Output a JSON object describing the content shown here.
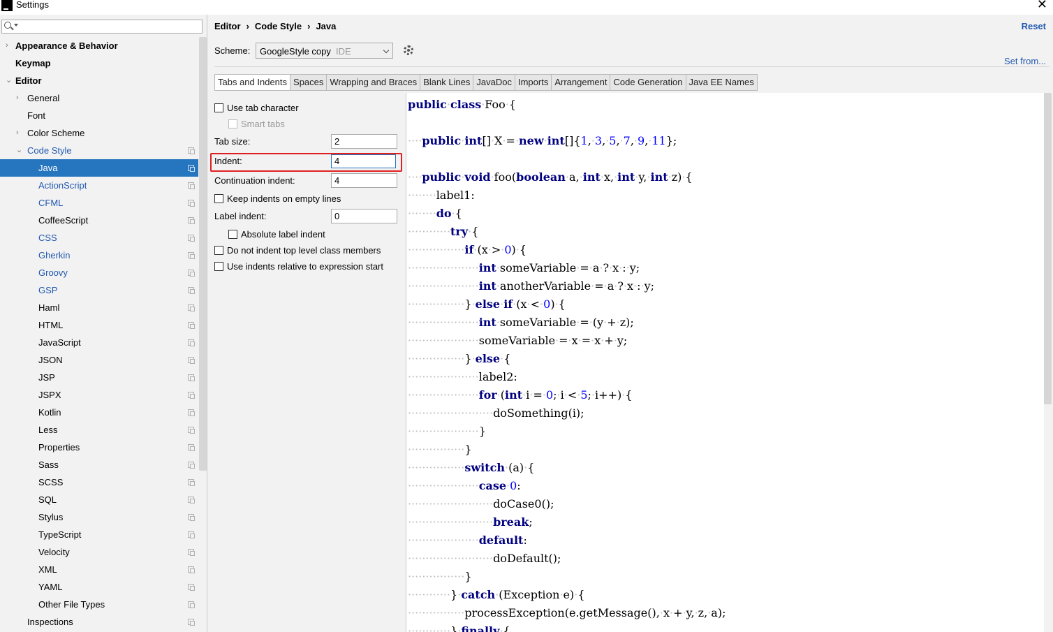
{
  "window": {
    "title": "Settings"
  },
  "search": {
    "placeholder": ""
  },
  "tree": [
    {
      "label": "Appearance & Behavior",
      "level": 0,
      "arrow": "›",
      "bold": true
    },
    {
      "label": "Keymap",
      "level": 0,
      "arrow": "",
      "bold": true
    },
    {
      "label": "Editor",
      "level": 0,
      "arrow": "⌄",
      "bold": true
    },
    {
      "label": "General",
      "level": 1,
      "arrow": "›"
    },
    {
      "label": "Font",
      "level": 1,
      "arrow": ""
    },
    {
      "label": "Color Scheme",
      "level": 1,
      "arrow": "›"
    },
    {
      "label": "Code Style",
      "level": 1,
      "arrow": "⌄",
      "blue": true,
      "copy": true
    },
    {
      "label": "Java",
      "level": 2,
      "selected": true,
      "copy": true
    },
    {
      "label": "ActionScript",
      "level": 2,
      "blue": true,
      "copy": true
    },
    {
      "label": "CFML",
      "level": 2,
      "blue": true,
      "copy": true
    },
    {
      "label": "CoffeeScript",
      "level": 2,
      "copy": true
    },
    {
      "label": "CSS",
      "level": 2,
      "blue": true,
      "copy": true
    },
    {
      "label": "Gherkin",
      "level": 2,
      "blue": true,
      "copy": true
    },
    {
      "label": "Groovy",
      "level": 2,
      "blue": true,
      "copy": true
    },
    {
      "label": "GSP",
      "level": 2,
      "blue": true,
      "copy": true
    },
    {
      "label": "Haml",
      "level": 2,
      "copy": true
    },
    {
      "label": "HTML",
      "level": 2,
      "copy": true
    },
    {
      "label": "JavaScript",
      "level": 2,
      "copy": true
    },
    {
      "label": "JSON",
      "level": 2,
      "copy": true
    },
    {
      "label": "JSP",
      "level": 2,
      "copy": true
    },
    {
      "label": "JSPX",
      "level": 2,
      "copy": true
    },
    {
      "label": "Kotlin",
      "level": 2,
      "copy": true
    },
    {
      "label": "Less",
      "level": 2,
      "copy": true
    },
    {
      "label": "Properties",
      "level": 2,
      "copy": true
    },
    {
      "label": "Sass",
      "level": 2,
      "copy": true
    },
    {
      "label": "SCSS",
      "level": 2,
      "copy": true
    },
    {
      "label": "SQL",
      "level": 2,
      "copy": true
    },
    {
      "label": "Stylus",
      "level": 2,
      "copy": true
    },
    {
      "label": "TypeScript",
      "level": 2,
      "copy": true
    },
    {
      "label": "Velocity",
      "level": 2,
      "copy": true
    },
    {
      "label": "XML",
      "level": 2,
      "copy": true
    },
    {
      "label": "YAML",
      "level": 2,
      "copy": true
    },
    {
      "label": "Other File Types",
      "level": 2,
      "copy": true
    },
    {
      "label": "Inspections",
      "level": 1,
      "arrow": "",
      "copy": true
    }
  ],
  "breadcrumb": {
    "part1": "Editor",
    "part2": "Code Style",
    "part3": "Java",
    "separator": "›"
  },
  "reset_label": "Reset",
  "scheme": {
    "label": "Scheme:",
    "value": "GoogleStyle copy",
    "tag": "IDE"
  },
  "set_from_label": "Set from...",
  "tabs": [
    "Tabs and Indents",
    "Spaces",
    "Wrapping and Braces",
    "Blank Lines",
    "JavaDoc",
    "Imports",
    "Arrangement",
    "Code Generation",
    "Java EE Names"
  ],
  "options": {
    "use_tab_character": "Use tab character",
    "smart_tabs": "Smart tabs",
    "tab_size_label": "Tab size:",
    "tab_size_value": "2",
    "indent_label": "Indent:",
    "indent_value": "4",
    "continuation_indent_label": "Continuation indent:",
    "continuation_indent_value": "4",
    "keep_indents_empty": "Keep indents on empty lines",
    "label_indent_label": "Label indent:",
    "label_indent_value": "0",
    "absolute_label_indent": "Absolute label indent",
    "no_indent_top_level": "Do not indent top level class members",
    "indents_relative_expr": "Use indents relative to expression start"
  },
  "code_lines": [
    [
      [
        "kw",
        "public"
      ],
      [
        "",
        "·"
      ],
      [
        "kw",
        "class"
      ],
      [
        "",
        "·Foo·{"
      ]
    ],
    [],
    [
      [
        "ws",
        "····"
      ],
      [
        "kw",
        "public"
      ],
      [
        "",
        "·"
      ],
      [
        "kw",
        "int"
      ],
      [
        "",
        "[]·X·=·"
      ],
      [
        "kw",
        "new"
      ],
      [
        "",
        "·"
      ],
      [
        "kw",
        "int"
      ],
      [
        "",
        "[]{"
      ],
      [
        "num",
        "1"
      ],
      [
        "",
        ",·"
      ],
      [
        "num",
        "3"
      ],
      [
        "",
        ",·"
      ],
      [
        "num",
        "5"
      ],
      [
        "",
        ",·"
      ],
      [
        "num",
        "7"
      ],
      [
        "",
        ",·"
      ],
      [
        "num",
        "9"
      ],
      [
        "",
        ",·"
      ],
      [
        "num",
        "11"
      ],
      [
        "",
        "};"
      ]
    ],
    [],
    [
      [
        "ws",
        "····"
      ],
      [
        "kw",
        "public"
      ],
      [
        "",
        "·"
      ],
      [
        "kw",
        "void"
      ],
      [
        "",
        "·foo("
      ],
      [
        "kw",
        "boolean"
      ],
      [
        "",
        "·a,·"
      ],
      [
        "kw",
        "int"
      ],
      [
        "",
        "·x,·"
      ],
      [
        "kw",
        "int"
      ],
      [
        "",
        "·y,·"
      ],
      [
        "kw",
        "int"
      ],
      [
        "",
        "·z)·{"
      ]
    ],
    [
      [
        "ws",
        "········"
      ],
      [
        "",
        "label1:"
      ]
    ],
    [
      [
        "ws",
        "········"
      ],
      [
        "kw",
        "do"
      ],
      [
        "",
        "·{"
      ]
    ],
    [
      [
        "ws",
        "············"
      ],
      [
        "kw",
        "try"
      ],
      [
        "",
        "·{"
      ]
    ],
    [
      [
        "ws",
        "················"
      ],
      [
        "kw",
        "if"
      ],
      [
        "",
        "·(x·>·"
      ],
      [
        "num",
        "0"
      ],
      [
        "",
        ")·{"
      ]
    ],
    [
      [
        "ws",
        "····················"
      ],
      [
        "kw",
        "int"
      ],
      [
        "",
        "·someVariable·=·a·?·x·:·y;"
      ]
    ],
    [
      [
        "ws",
        "····················"
      ],
      [
        "kw",
        "int"
      ],
      [
        "",
        "·anotherVariable·=·a·?·x·:·y;"
      ]
    ],
    [
      [
        "ws",
        "················"
      ],
      [
        "",
        "}·"
      ],
      [
        "kw",
        "else"
      ],
      [
        "",
        "·"
      ],
      [
        "kw",
        "if"
      ],
      [
        "",
        "·(x·<·"
      ],
      [
        "num",
        "0"
      ],
      [
        "",
        ")·{"
      ]
    ],
    [
      [
        "ws",
        "····················"
      ],
      [
        "kw",
        "int"
      ],
      [
        "",
        "·someVariable·=·(y·+·z);"
      ]
    ],
    [
      [
        "ws",
        "····················"
      ],
      [
        "",
        "someVariable·=·x·=·x·+·y;"
      ]
    ],
    [
      [
        "ws",
        "················"
      ],
      [
        "",
        "}·"
      ],
      [
        "kw",
        "else"
      ],
      [
        "",
        "·{"
      ]
    ],
    [
      [
        "ws",
        "····················"
      ],
      [
        "",
        "label2:"
      ]
    ],
    [
      [
        "ws",
        "····················"
      ],
      [
        "kw",
        "for"
      ],
      [
        "",
        "·("
      ],
      [
        "kw",
        "int"
      ],
      [
        "",
        "·i·=·"
      ],
      [
        "num",
        "0"
      ],
      [
        "",
        ";·i·<·"
      ],
      [
        "num",
        "5"
      ],
      [
        "",
        ";·i++)·{"
      ]
    ],
    [
      [
        "ws",
        "························"
      ],
      [
        "",
        "doSomething(i);"
      ]
    ],
    [
      [
        "ws",
        "····················"
      ],
      [
        "",
        "}"
      ]
    ],
    [
      [
        "ws",
        "················"
      ],
      [
        "",
        "}"
      ]
    ],
    [
      [
        "ws",
        "················"
      ],
      [
        "kw",
        "switch"
      ],
      [
        "",
        "·(a)·{"
      ]
    ],
    [
      [
        "ws",
        "····················"
      ],
      [
        "kw",
        "case"
      ],
      [
        "",
        "·"
      ],
      [
        "num",
        "0"
      ],
      [
        "",
        ":"
      ]
    ],
    [
      [
        "ws",
        "························"
      ],
      [
        "",
        "doCase0();"
      ]
    ],
    [
      [
        "ws",
        "························"
      ],
      [
        "kw",
        "break"
      ],
      [
        "",
        ";"
      ]
    ],
    [
      [
        "ws",
        "····················"
      ],
      [
        "kw",
        "default"
      ],
      [
        "",
        ":"
      ]
    ],
    [
      [
        "ws",
        "························"
      ],
      [
        "",
        "doDefault();"
      ]
    ],
    [
      [
        "ws",
        "················"
      ],
      [
        "",
        "}"
      ]
    ],
    [
      [
        "ws",
        "············"
      ],
      [
        "",
        "}·"
      ],
      [
        "kw",
        "catch"
      ],
      [
        "",
        "·(Exception·e)·{"
      ]
    ],
    [
      [
        "ws",
        "················"
      ],
      [
        "",
        "processException(e.getMessage(),·x·+·y,·z,·a);"
      ]
    ],
    [
      [
        "ws",
        "············"
      ],
      [
        "",
        "}·"
      ],
      [
        "kw",
        "finally"
      ],
      [
        "",
        "·{"
      ]
    ]
  ]
}
